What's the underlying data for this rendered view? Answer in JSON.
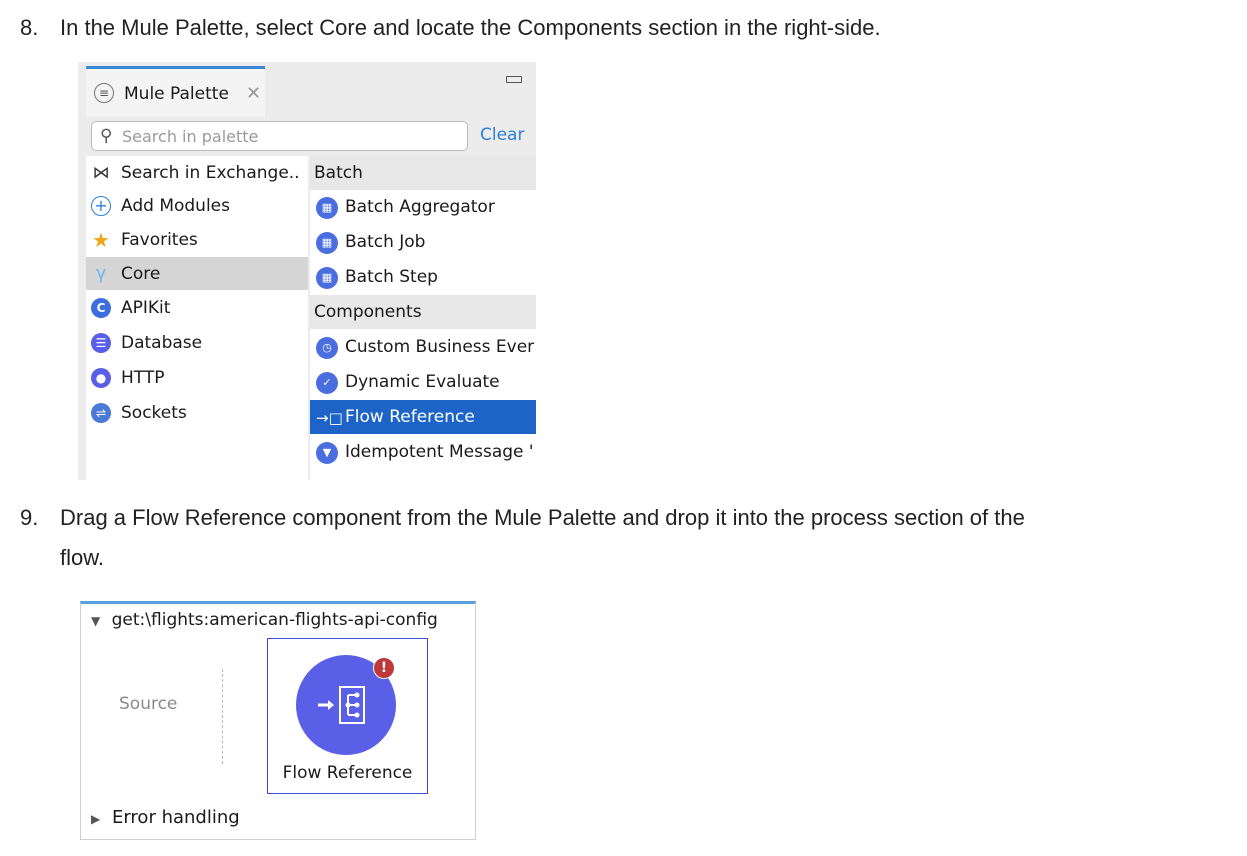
{
  "steps": [
    {
      "number": "8.",
      "text": "In the Mule Palette, select Core and locate the Components section in the right-side."
    },
    {
      "number": "9.",
      "text": "Drag a Flow Reference component from the Mule Palette and drop it into the process section of the",
      "text2": "flow."
    }
  ],
  "palette": {
    "tab_title": "Mule Palette",
    "search_placeholder": "Search in palette",
    "clear_label": "Clear",
    "left_items": [
      {
        "label": "Search in Exchange..",
        "icon": "exchange-icon"
      },
      {
        "label": "Add Modules",
        "icon": "plus-circle-icon"
      },
      {
        "label": "Favorites",
        "icon": "star-icon"
      },
      {
        "label": "Core",
        "icon": "mule-core-icon",
        "selected": true
      },
      {
        "label": "APIKit",
        "icon": "apikit-icon"
      },
      {
        "label": "Database",
        "icon": "database-icon"
      },
      {
        "label": "HTTP",
        "icon": "http-icon"
      },
      {
        "label": "Sockets",
        "icon": "sockets-icon"
      }
    ],
    "right_rows": [
      {
        "label": "Batch",
        "type": "header"
      },
      {
        "label": "Batch Aggregator",
        "type": "item"
      },
      {
        "label": "Batch Job",
        "type": "item"
      },
      {
        "label": "Batch Step",
        "type": "item"
      },
      {
        "label": "Components",
        "type": "header"
      },
      {
        "label": "Custom Business Ever",
        "type": "item"
      },
      {
        "label": "Dynamic Evaluate",
        "type": "item"
      },
      {
        "label": "Flow Reference",
        "type": "item",
        "highlighted": true
      },
      {
        "label": "Idempotent Message '",
        "type": "item"
      }
    ]
  },
  "flow": {
    "name": "get:\\flights:american-flights-api-config",
    "source_label": "Source",
    "component_label": "Flow Reference",
    "error_badge": "!",
    "error_handling_label": "Error handling"
  },
  "colors": {
    "accent": "#1e64c8",
    "component": "#5a5fe8",
    "error": "#c0393a",
    "link": "#2d7fd6"
  }
}
